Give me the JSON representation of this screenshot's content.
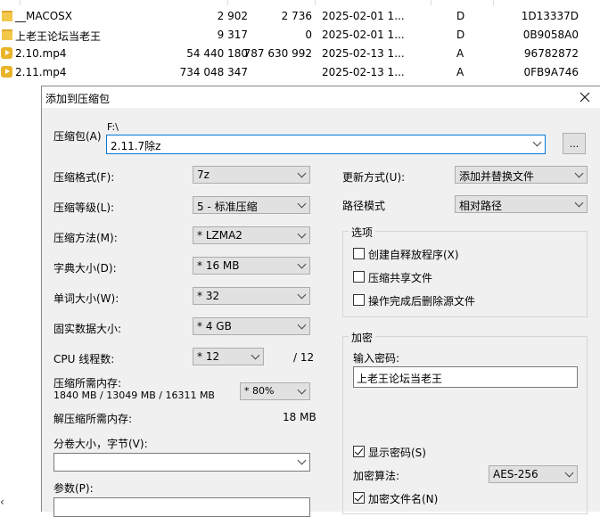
{
  "file_list": {
    "rows": [
      {
        "name": "__MACOSX",
        "size": "2 902",
        "packed": "2 736",
        "modified": "2025-02-01 1...",
        "attr": "D",
        "crc": "1D13337D",
        "icon": "folder-icon"
      },
      {
        "name": "上老王论坛当老王",
        "size": "9 317",
        "packed": "0",
        "modified": "2025-02-01 1...",
        "attr": "D",
        "crc": "0B9058A0",
        "icon": "folder-icon"
      },
      {
        "name": "2.10.mp4",
        "size": "54 440 180",
        "packed": "787 630 992",
        "modified": "2025-02-13 1...",
        "attr": "A",
        "crc": "96782872",
        "icon": "video-file-icon"
      },
      {
        "name": "2.11.mp4",
        "size": "734 048 347",
        "packed": "",
        "modified": "2025-02-13 1...",
        "attr": "A",
        "crc": "0FB9A746",
        "icon": "video-file-icon"
      }
    ]
  },
  "dialog": {
    "title": "添加到压缩包",
    "archive": {
      "label": "压缩包(A)",
      "path": "F:\\",
      "value": "2.11.7除z",
      "browse_label": "..."
    },
    "format": {
      "label": "压缩格式(F):",
      "value": "7z"
    },
    "level": {
      "label": "压缩等级(L):",
      "value": "5 - 标准压缩"
    },
    "method": {
      "label": "压缩方法(M):",
      "value": "* LZMA2"
    },
    "dict": {
      "label": "字典大小(D):",
      "value": "* 16 MB"
    },
    "word": {
      "label": "单词大小(W):",
      "value": "* 32"
    },
    "solid": {
      "label": "固实数据大小:",
      "value": "* 4 GB"
    },
    "threads": {
      "label": "CPU 线程数:",
      "value": "* 12",
      "max": "/ 12"
    },
    "memory": {
      "label": "压缩所需内存:",
      "detail": "1840 MB / 13049 MB / 16311 MB",
      "value": "* 80%"
    },
    "decompress_memory": {
      "label": "解压缩所需内存:",
      "value": "18 MB"
    },
    "split": {
      "label": "分卷大小，字节(V):",
      "value": ""
    },
    "params": {
      "label": "参数(P):"
    },
    "update_mode": {
      "label": "更新方式(U):",
      "value": "添加并替换文件"
    },
    "path_mode": {
      "label": "路径模式",
      "value": "相对路径"
    },
    "options": {
      "title": "选项",
      "items": [
        {
          "label": "创建自释放程序(X)",
          "checked": false
        },
        {
          "label": "压缩共享文件",
          "checked": false
        },
        {
          "label": "操作完成后删除源文件",
          "checked": false
        }
      ]
    },
    "encryption": {
      "title": "加密",
      "password_label": "输入密码:",
      "password_value": "上老王论坛当老王",
      "show_password_label": "显示密码(S)",
      "show_password_checked": true,
      "method_label": "加密算法:",
      "method_value": "AES-256",
      "encrypt_names_label": "加密文件名(N)",
      "encrypt_names_checked": true
    }
  },
  "scroll_left_glyph": "‹"
}
